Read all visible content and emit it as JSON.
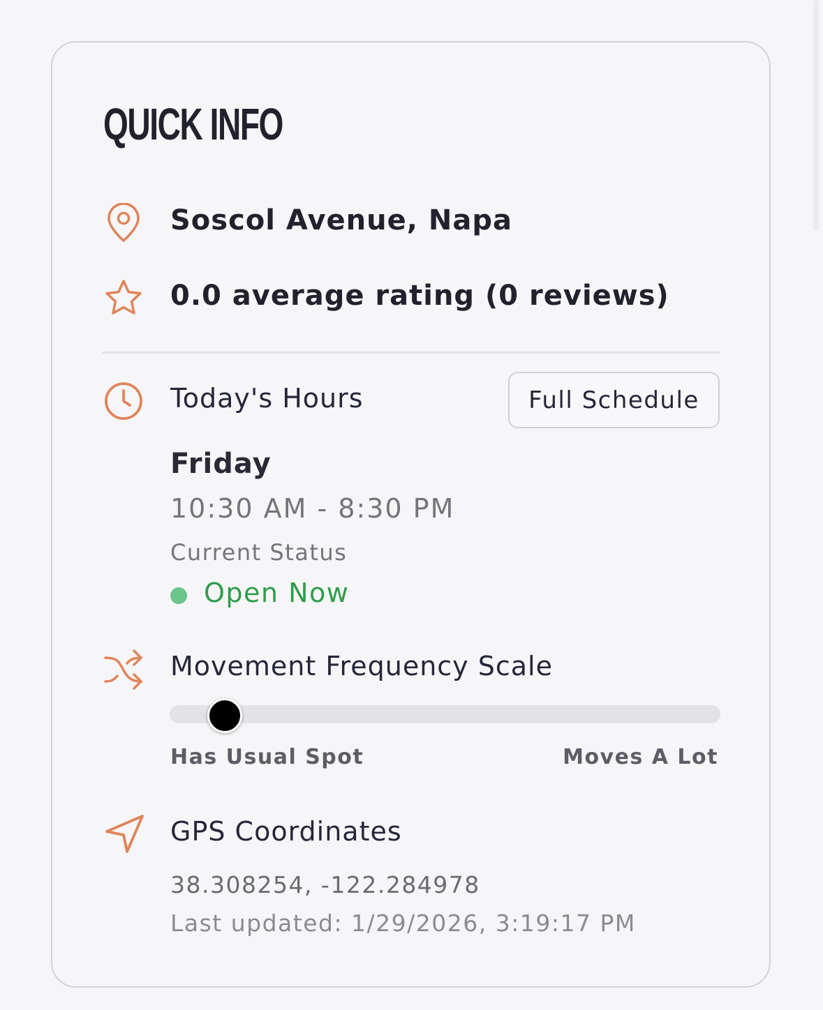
{
  "quick_info": {
    "title": "QUICK INFO",
    "location": "Soscol Avenue, Napa",
    "rating_text": "0.0 average rating (0 reviews)",
    "hours": {
      "label": "Today's Hours",
      "full_schedule_button": "Full Schedule",
      "day": "Friday",
      "time_range": "10:30 AM - 8:30 PM",
      "status_label": "Current Status",
      "status_value": "Open Now"
    },
    "movement": {
      "label": "Movement Frequency Scale",
      "value_fraction": 0.1,
      "min_label": "Has Usual Spot",
      "max_label": "Moves A Lot"
    },
    "gps": {
      "label": "GPS Coordinates",
      "coordinates": "38.308254, -122.284978",
      "last_updated": "Last updated: 1/29/2026, 3:19:17 PM"
    }
  },
  "colors": {
    "accent": "#e0845a",
    "status_green": "#2f9d4b",
    "status_dot": "#6cc58a"
  },
  "icons": {
    "location": "map-pin-icon",
    "rating": "star-icon",
    "hours": "clock-icon",
    "movement": "shuffle-icon",
    "gps": "navigation-arrow-icon"
  }
}
